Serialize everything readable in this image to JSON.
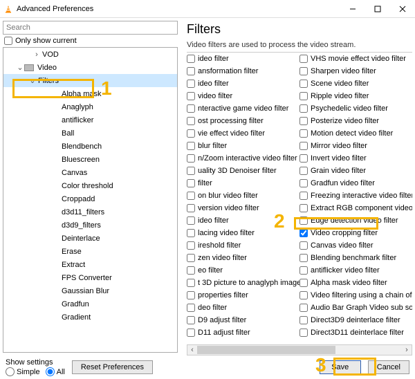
{
  "window": {
    "title": "Advanced Preferences"
  },
  "search": {
    "placeholder": "Search"
  },
  "only_show_label": "Only show current",
  "tree": [
    {
      "label": "VOD",
      "indent": 36,
      "twisty": ">",
      "icon": false
    },
    {
      "label": "Video",
      "indent": 12,
      "twisty": "v",
      "icon": true
    },
    {
      "label": "Filters",
      "indent": 30,
      "twisty": "v",
      "icon": false,
      "selected": true
    },
    {
      "label": "Alpha mask",
      "indent": 64,
      "twisty": "",
      "icon": false
    },
    {
      "label": "Anaglyph",
      "indent": 64,
      "twisty": "",
      "icon": false
    },
    {
      "label": "antiflicker",
      "indent": 64,
      "twisty": "",
      "icon": false
    },
    {
      "label": "Ball",
      "indent": 64,
      "twisty": "",
      "icon": false
    },
    {
      "label": "Blendbench",
      "indent": 64,
      "twisty": "",
      "icon": false
    },
    {
      "label": "Bluescreen",
      "indent": 64,
      "twisty": "",
      "icon": false
    },
    {
      "label": "Canvas",
      "indent": 64,
      "twisty": "",
      "icon": false
    },
    {
      "label": "Color threshold",
      "indent": 64,
      "twisty": "",
      "icon": false
    },
    {
      "label": "Croppadd",
      "indent": 64,
      "twisty": "",
      "icon": false
    },
    {
      "label": "d3d11_filters",
      "indent": 64,
      "twisty": "",
      "icon": false
    },
    {
      "label": "d3d9_filters",
      "indent": 64,
      "twisty": "",
      "icon": false
    },
    {
      "label": "Deinterlace",
      "indent": 64,
      "twisty": "",
      "icon": false
    },
    {
      "label": "Erase",
      "indent": 64,
      "twisty": "",
      "icon": false
    },
    {
      "label": "Extract",
      "indent": 64,
      "twisty": "",
      "icon": false
    },
    {
      "label": "FPS Converter",
      "indent": 64,
      "twisty": "",
      "icon": false
    },
    {
      "label": "Gaussian Blur",
      "indent": 64,
      "twisty": "",
      "icon": false
    },
    {
      "label": "Gradfun",
      "indent": 64,
      "twisty": "",
      "icon": false
    },
    {
      "label": "Gradient",
      "indent": 64,
      "twisty": "",
      "icon": false
    }
  ],
  "panel": {
    "title": "Filters",
    "desc": "Video filters are used to process the video stream."
  },
  "filters_left": [
    "ideo filter",
    "ansformation filter",
    "ideo filter",
    "video filter",
    "nteractive game video filter",
    "ost processing filter",
    "vie effect video filter",
    "blur filter",
    "n/Zoom interactive video filter",
    "uality 3D Denoiser filter",
    "filter",
    "on blur video filter",
    "version video filter",
    "ideo filter",
    "lacing video filter",
    "ireshold filter",
    "zen video filter",
    "eo filter",
    "t 3D picture to anaglyph image video filter",
    "properties filter",
    "deo filter",
    "D9 adjust filter",
    "D11 adjust filter"
  ],
  "filters_right": [
    {
      "label": "VHS movie effect video filter",
      "checked": false
    },
    {
      "label": "Sharpen video filter",
      "checked": false
    },
    {
      "label": "Scene video filter",
      "checked": false
    },
    {
      "label": "Ripple video filter",
      "checked": false
    },
    {
      "label": "Psychedelic video filter",
      "checked": false
    },
    {
      "label": "Posterize video filter",
      "checked": false
    },
    {
      "label": "Motion detect video filter",
      "checked": false
    },
    {
      "label": "Mirror video filter",
      "checked": false
    },
    {
      "label": "Invert video filter",
      "checked": false
    },
    {
      "label": "Grain video filter",
      "checked": false
    },
    {
      "label": "Gradfun video filter",
      "checked": false
    },
    {
      "label": "Freezing interactive video filter",
      "checked": false
    },
    {
      "label": "Extract RGB component video filter",
      "checked": false
    },
    {
      "label": "Edge detection video filter",
      "checked": false
    },
    {
      "label": "Video cropping filter",
      "checked": true
    },
    {
      "label": "Canvas video filter",
      "checked": false
    },
    {
      "label": "Blending benchmark filter",
      "checked": false
    },
    {
      "label": "antiflicker video filter",
      "checked": false
    },
    {
      "label": "Alpha mask video filter",
      "checked": false
    },
    {
      "label": "Video filtering using a chain of video filt",
      "checked": false
    },
    {
      "label": "Audio Bar Graph Video sub source",
      "checked": false
    },
    {
      "label": "Direct3D9 deinterlace filter",
      "checked": false
    },
    {
      "label": "Direct3D11 deinterlace filter",
      "checked": false
    }
  ],
  "bottom": {
    "show_settings": "Show settings",
    "simple": "Simple",
    "all": "All",
    "reset": "Reset Preferences",
    "save": "Save",
    "cancel": "Cancel"
  },
  "annotations": {
    "n1": "1",
    "n2": "2",
    "n3": "3"
  }
}
